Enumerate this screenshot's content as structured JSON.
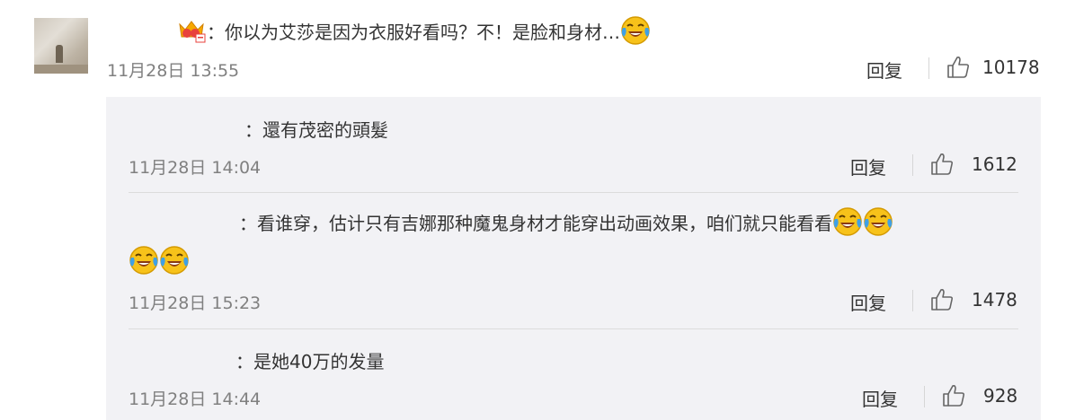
{
  "comment": {
    "text": "：你以为艾莎是因为衣服好看吗？不！是脸和身材…",
    "timestamp": "11月28日 13:55",
    "reply_label": "回复",
    "like_count": "10178"
  },
  "replies": [
    {
      "text": "：還有茂密的頭髮",
      "timestamp": "11月28日 14:04",
      "reply_label": "回复",
      "like_count": "1612"
    },
    {
      "text": "：看谁穿，估计只有吉娜那种魔鬼身材才能穿出动画效果，咱们就只能看看",
      "timestamp": "11月28日 15:23",
      "reply_label": "回复",
      "like_count": "1478"
    },
    {
      "text": "：是她40万的发量",
      "timestamp": "11月28日 14:44",
      "reply_label": "回复",
      "like_count": "928"
    }
  ],
  "icons": {
    "emoji": "laugh-cry-emoji",
    "badge": "crown-badge-icon",
    "like": "thumbs-up-icon"
  },
  "colors": {
    "emoji_face": "#f7c21a",
    "tears": "#3fa0e6",
    "timestamp": "#808080",
    "reply_bg": "#f2f2f5"
  }
}
